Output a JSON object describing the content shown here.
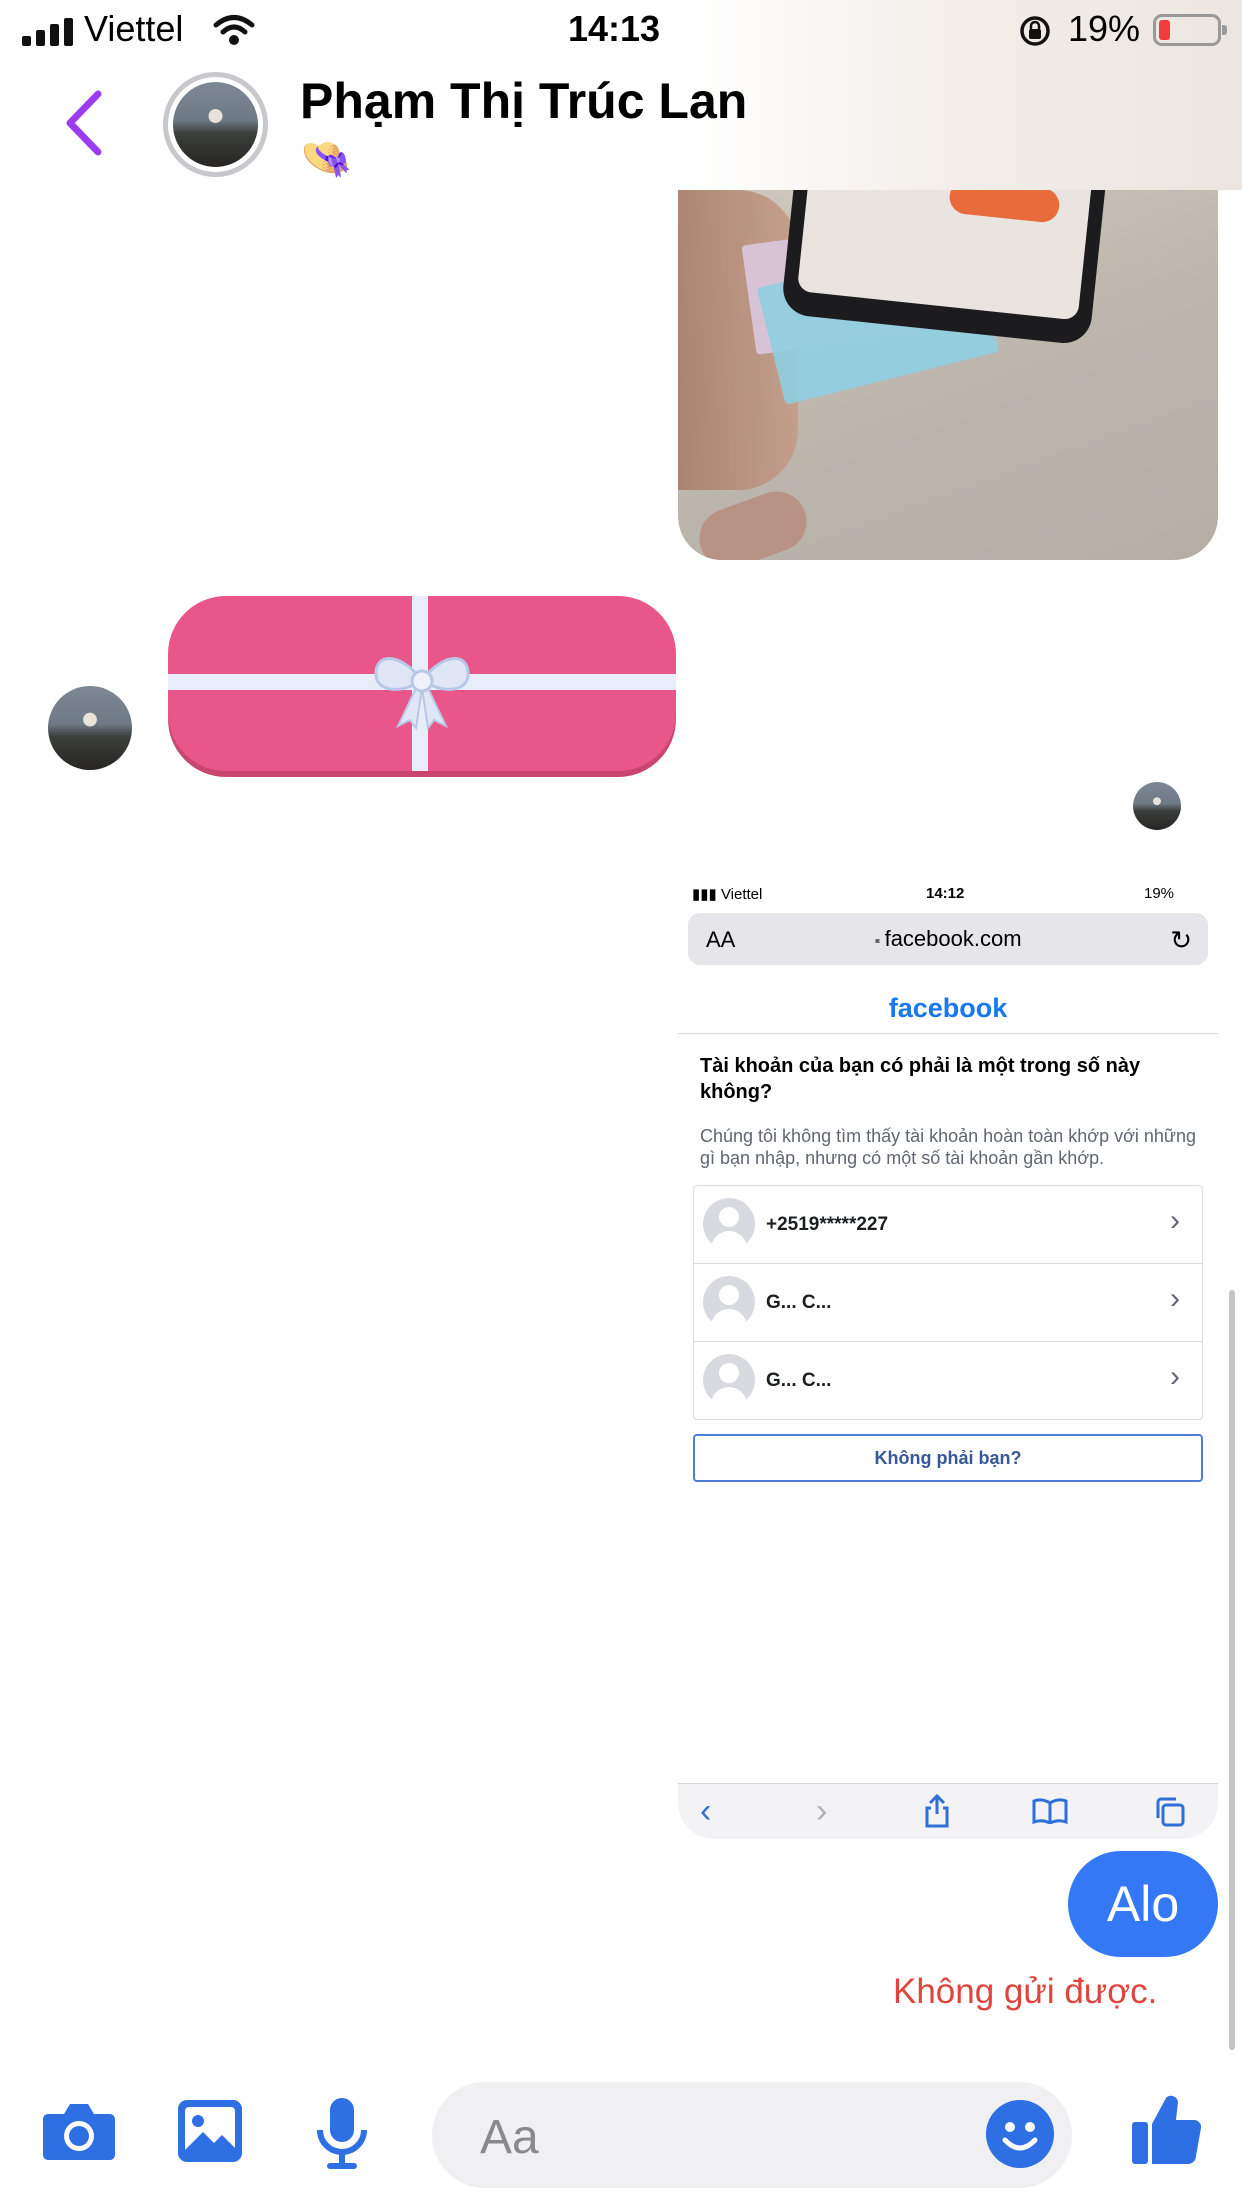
{
  "status_bar": {
    "carrier": "Viettel",
    "time": "14:13",
    "battery": "19%",
    "battery_level": 0.19
  },
  "header": {
    "contact_name": "Phạm Thị Trúc Lan",
    "status_emoji": "👒"
  },
  "embedded_screenshot": {
    "carrier": "Viettel",
    "time": "14:12",
    "battery": "19%",
    "url_aa": "AA",
    "url": "facebook.com",
    "logo": "facebook",
    "question": "Tài khoản của bạn có phải là một trong số này không?",
    "description": "Chúng tôi không tìm thấy tài khoản hoàn toàn khớp với những gì bạn nhập, nhưng có một số tài khoản gần khớp.",
    "accounts": [
      {
        "name": "+2519*****227"
      },
      {
        "name": "G... C..."
      },
      {
        "name": "G... C..."
      }
    ],
    "not_you_button": "Không phải bạn?"
  },
  "messages": {
    "sent_text": "Alo",
    "error_text": "Không gửi được."
  },
  "composer": {
    "placeholder": "Aa"
  },
  "colors": {
    "accent": "#3478f6",
    "back_arrow": "#9b3cf0",
    "gift": "#e9578a",
    "error": "#e0443e",
    "facebook": "#1877f2"
  },
  "icons": [
    "chevron-left-icon",
    "camera-icon",
    "gallery-icon",
    "microphone-icon",
    "emoji-icon",
    "thumbs-up-icon",
    "wifi-icon",
    "lock-icon",
    "reload-icon",
    "chevron-right-icon",
    "share-icon",
    "bookmarks-icon",
    "tabs-icon",
    "gift-bow-icon"
  ]
}
